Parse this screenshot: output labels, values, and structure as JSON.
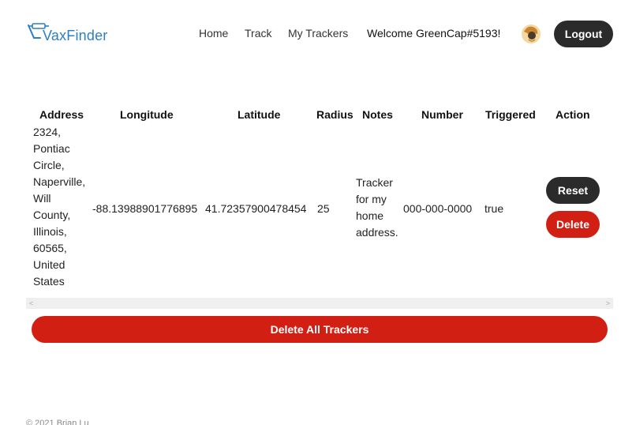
{
  "header": {
    "logo_text": "VaxFinder",
    "nav": [
      {
        "label": "Home"
      },
      {
        "label": "Track"
      },
      {
        "label": "My Trackers"
      }
    ],
    "welcome": "Welcome GreenCap#5193!",
    "logout_label": "Logout"
  },
  "table": {
    "columns": [
      "Address",
      "Longitude",
      "Latitude",
      "Radius",
      "Notes",
      "Number",
      "Triggered",
      "Action"
    ],
    "rows": [
      {
        "address_lines": [
          "2324,",
          "Pontiac",
          "Circle,",
          "Naperville,",
          "Will",
          "County,",
          "Illinois,",
          "60565,",
          "United",
          "States"
        ],
        "longitude": "-88.13988901776895",
        "latitude": "41.72357900478454",
        "radius": "25",
        "notes_lines": [
          "Tracker",
          "for my",
          "home",
          "address."
        ],
        "number": "000-000-0000",
        "triggered": "true",
        "reset_label": "Reset",
        "delete_label": "Delete"
      }
    ]
  },
  "scrollbar": {
    "left_arrow": "<",
    "right_arrow": ">"
  },
  "delete_all_label": "Delete All Trackers",
  "footer": "© 2021 Brian Lu",
  "colors": {
    "brand": "#2d7fc4",
    "dark_button": "#2b2b2b",
    "danger": "#d21f14"
  }
}
